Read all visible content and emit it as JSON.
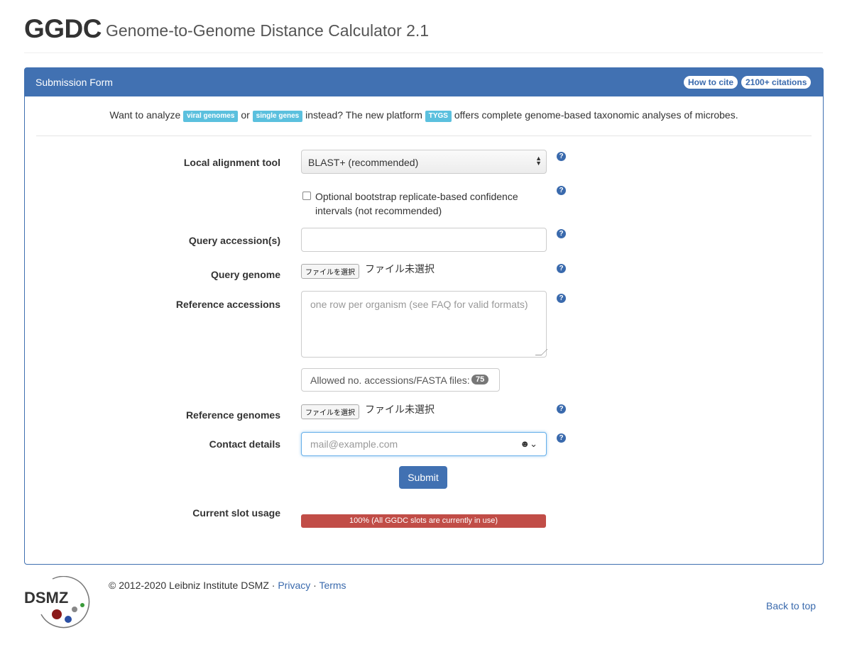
{
  "header": {
    "brand": "GGDC",
    "subtitle": "Genome-to-Genome Distance Calculator 2.1"
  },
  "panel": {
    "title": "Submission Form",
    "how_to_cite": "How to cite",
    "citations": "2100+ citations"
  },
  "notice": {
    "prefix": "Want to analyze",
    "tag_viral": "viral genomes",
    "or": "or",
    "tag_single": "single genes",
    "middle": "instead? The new platform",
    "tag_tygs": "TYGS",
    "suffix": "offers complete genome-based taxonomic analyses of microbes."
  },
  "form": {
    "alignment_label": "Local alignment tool",
    "alignment_value": "BLAST+ (recommended)",
    "bootstrap_text": "Optional bootstrap replicate-based confidence intervals (not recommended)",
    "query_accessions_label": "Query accession(s)",
    "query_genome_label": "Query genome",
    "file_button": "ファイルを選択",
    "file_status": "ファイル未選択",
    "reference_accessions_label": "Reference accessions",
    "reference_accessions_placeholder": "one row per organism (see FAQ for valid formats)",
    "allowed_label": "Allowed no. accessions/FASTA files:",
    "allowed_count": "75",
    "reference_genomes_label": "Reference genomes",
    "contact_label": "Contact details",
    "contact_placeholder": "mail@example.com",
    "submit_label": "Submit",
    "slot_label": "Current slot usage",
    "slot_text": "100% (All GGDC slots are currently in use)",
    "slot_percent": 100
  },
  "footer": {
    "logo_text": "DSMZ",
    "copyright": "© 2012-2020 Leibniz Institute DSMZ ·",
    "privacy": "Privacy",
    "sep": "·",
    "terms": "Terms",
    "back_to_top": "Back to top"
  },
  "colors": {
    "primary": "#4171b2",
    "info": "#5bc0de",
    "danger": "#c14d47"
  }
}
